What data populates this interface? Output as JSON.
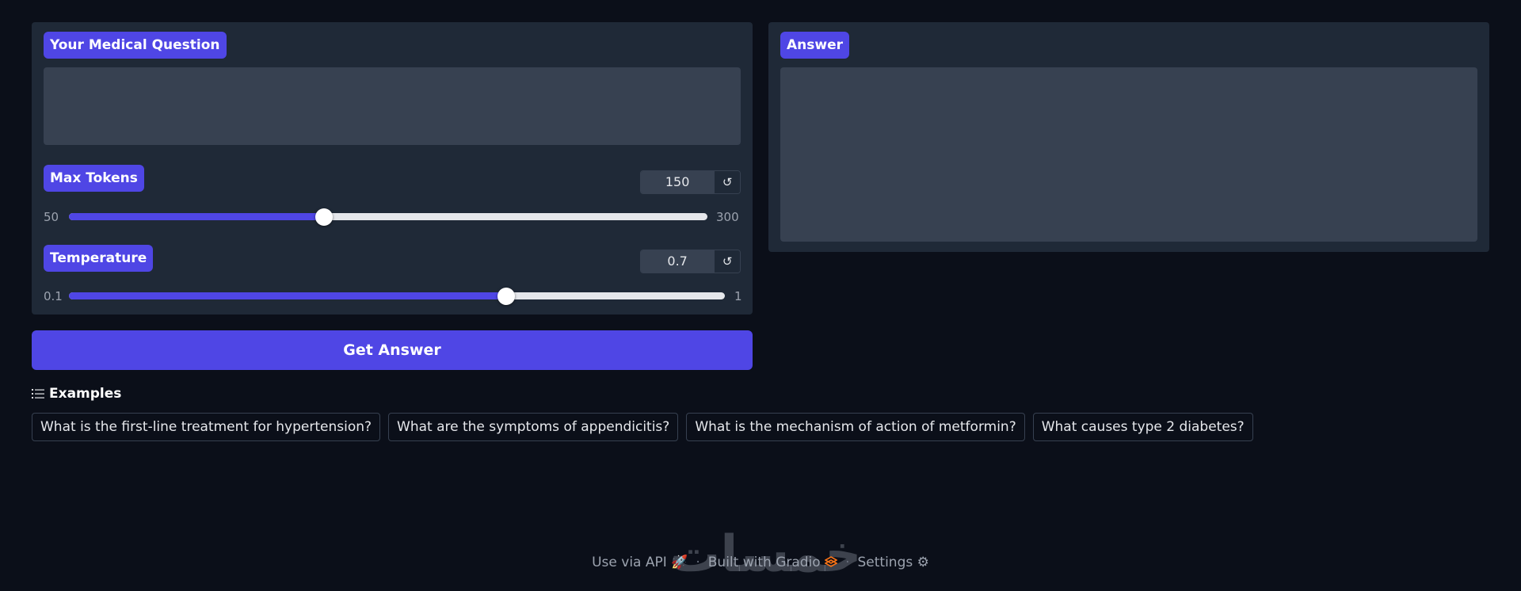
{
  "question": {
    "label": "Your Medical Question",
    "value": ""
  },
  "answer": {
    "label": "Answer",
    "value": ""
  },
  "max_tokens": {
    "label": "Max Tokens",
    "value": "150",
    "min": "50",
    "max": "300",
    "reset_icon": "↺"
  },
  "temperature": {
    "label": "Temperature",
    "value": "0.7",
    "min": "0.1",
    "max": "1",
    "reset_icon": "↺"
  },
  "submit": {
    "label": "Get Answer"
  },
  "examples": {
    "header": "Examples",
    "icon": "list-icon",
    "items": [
      "What is the first-line treatment for hypertension?",
      "What are the symptoms of appendicitis?",
      "What is the mechanism of action of metformin?",
      "What causes type 2 diabetes?"
    ]
  },
  "footer": {
    "api": "Use via API",
    "api_icon": "rocket-icon",
    "built": "Built with Gradio",
    "built_icon": "gradio-logo-icon",
    "settings": "Settings",
    "settings_icon": "gear-icon",
    "separator": "·"
  },
  "watermark": "خمسات",
  "colors": {
    "background": "#0b0f19",
    "panel": "#1f2937",
    "input": "#374151",
    "accent": "#4f46e5",
    "text": "#e5e7eb",
    "muted": "#9ca3af"
  }
}
